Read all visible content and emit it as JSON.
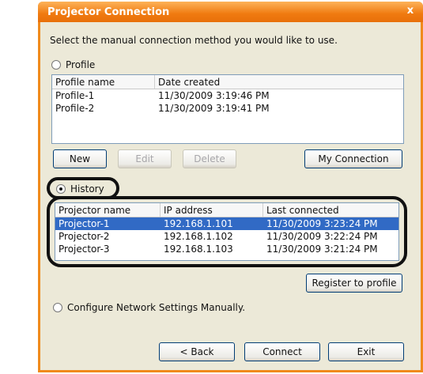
{
  "window": {
    "title": "Projector Connection",
    "close_glyph": "x"
  },
  "instruction": "Select the manual connection method you would like to use.",
  "profile": {
    "radio_label": "Profile",
    "columns": [
      "Profile name",
      "Date created"
    ],
    "rows": [
      {
        "name": "Profile-1",
        "date": "11/30/2009 3:19:46 PM"
      },
      {
        "name": "Profile-2",
        "date": "11/30/2009 3:19:41 PM"
      }
    ],
    "buttons": {
      "new": "New",
      "edit": "Edit",
      "delete": "Delete",
      "my_connection": "My Connection"
    }
  },
  "history": {
    "radio_label": "History",
    "columns": [
      "Projector name",
      "IP address",
      "Last connected"
    ],
    "rows": [
      {
        "name": "Projector-1",
        "ip": "192.168.1.101",
        "last": "11/30/2009 3:23:24 PM"
      },
      {
        "name": "Projector-2",
        "ip": "192.168.1.102",
        "last": "11/30/2009 3:22:24 PM"
      },
      {
        "name": "Projector-3",
        "ip": "192.168.1.103",
        "last": "11/30/2009 3:21:24 PM"
      }
    ],
    "register_button": "Register to profile"
  },
  "configure": {
    "radio_label": "Configure Network Settings Manually."
  },
  "footer": {
    "back": "< Back",
    "connect": "Connect",
    "exit": "Exit"
  },
  "colors": {
    "title_orange": "#f07a10",
    "selection_blue": "#316ac5"
  }
}
